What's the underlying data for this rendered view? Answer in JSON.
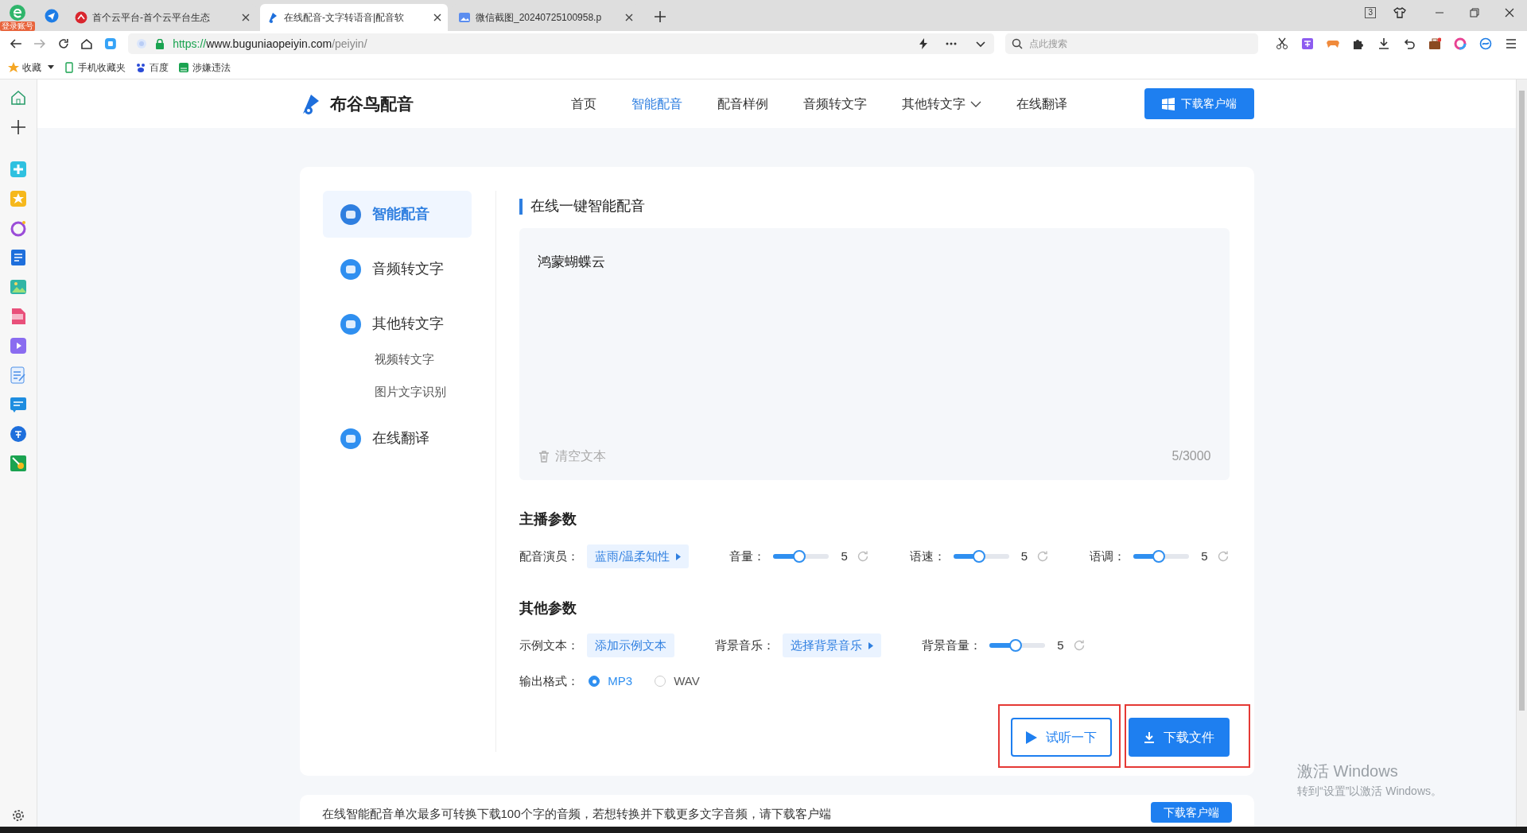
{
  "browser": {
    "login_badge": "登录账号",
    "tabs": [
      {
        "title": "首个云平台-首个云平台生态",
        "selected": false
      },
      {
        "title": "在线配音-文字转语音|配音软",
        "selected": true
      },
      {
        "title": "微信截图_20240725100958.p",
        "selected": false
      }
    ],
    "tab_count": "3",
    "address": {
      "scheme": "https://",
      "host": "www.buguniaopeiyin.com",
      "path": "/peiyin/"
    },
    "search": {
      "placeholder": "点此搜索"
    },
    "bookmarks": [
      "收藏",
      "手机收藏夹",
      "百度",
      "涉嫌违法"
    ]
  },
  "site": {
    "logo": "布谷鸟配音",
    "nav": [
      {
        "label": "首页",
        "selected": false,
        "dropdown": false
      },
      {
        "label": "智能配音",
        "selected": true,
        "dropdown": false
      },
      {
        "label": "配音样例",
        "selected": false,
        "dropdown": false
      },
      {
        "label": "音频转文字",
        "selected": false,
        "dropdown": false
      },
      {
        "label": "其他转文字",
        "selected": false,
        "dropdown": true
      },
      {
        "label": "在线翻译",
        "selected": false,
        "dropdown": false
      }
    ],
    "download_button": "下载客户端"
  },
  "side_menu": [
    {
      "label": "智能配音",
      "selected": true
    },
    {
      "label": "音频转文字",
      "selected": false
    },
    {
      "label": "其他转文字",
      "selected": false,
      "children": [
        {
          "label": "视频转文字"
        },
        {
          "label": "图片文字识别"
        }
      ]
    },
    {
      "label": "在线翻译",
      "selected": false
    }
  ],
  "editor": {
    "title": "在线一键智能配音",
    "text": "鸿蒙蝴蝶云",
    "clear": "清空文本",
    "count": "5/3000"
  },
  "anchor_params": {
    "title": "主播参数",
    "items": [
      {
        "kind": "select",
        "label": "配音演员：",
        "value": "蓝雨/温柔知性"
      },
      {
        "kind": "slider",
        "label": "音量：",
        "level": 0.45,
        "value": "5"
      },
      {
        "kind": "slider",
        "label": "语速：",
        "level": 0.45,
        "value": "5"
      },
      {
        "kind": "slider",
        "label": "语调：",
        "level": 0.45,
        "value": "5"
      }
    ]
  },
  "other_params": {
    "title": "其他参数",
    "items": [
      {
        "kind": "button",
        "label": "示例文本：",
        "value": "添加示例文本"
      },
      {
        "kind": "select",
        "label": "背景音乐：",
        "value": "选择背景音乐"
      },
      {
        "kind": "slider",
        "label": "背景音量：",
        "level": 0.45,
        "value": "5"
      }
    ],
    "format": {
      "label": "输出格式：",
      "options": [
        {
          "label": "MP3",
          "selected": true
        },
        {
          "label": "WAV",
          "selected": false
        }
      ]
    }
  },
  "actions": [
    {
      "label": "试听一下",
      "kind": "outline",
      "highlighted": true
    },
    {
      "label": "下载文件",
      "kind": "solid",
      "highlighted": true
    }
  ],
  "banner": {
    "text": "在线智能配音单次最多可转换下载100个字的音频，若想转换并下载更多文字音频，请下载客户端",
    "button": "下载客户端"
  },
  "windows_notice": {
    "title": "激活 Windows",
    "text": "转到“设置”以激活 Windows。"
  }
}
